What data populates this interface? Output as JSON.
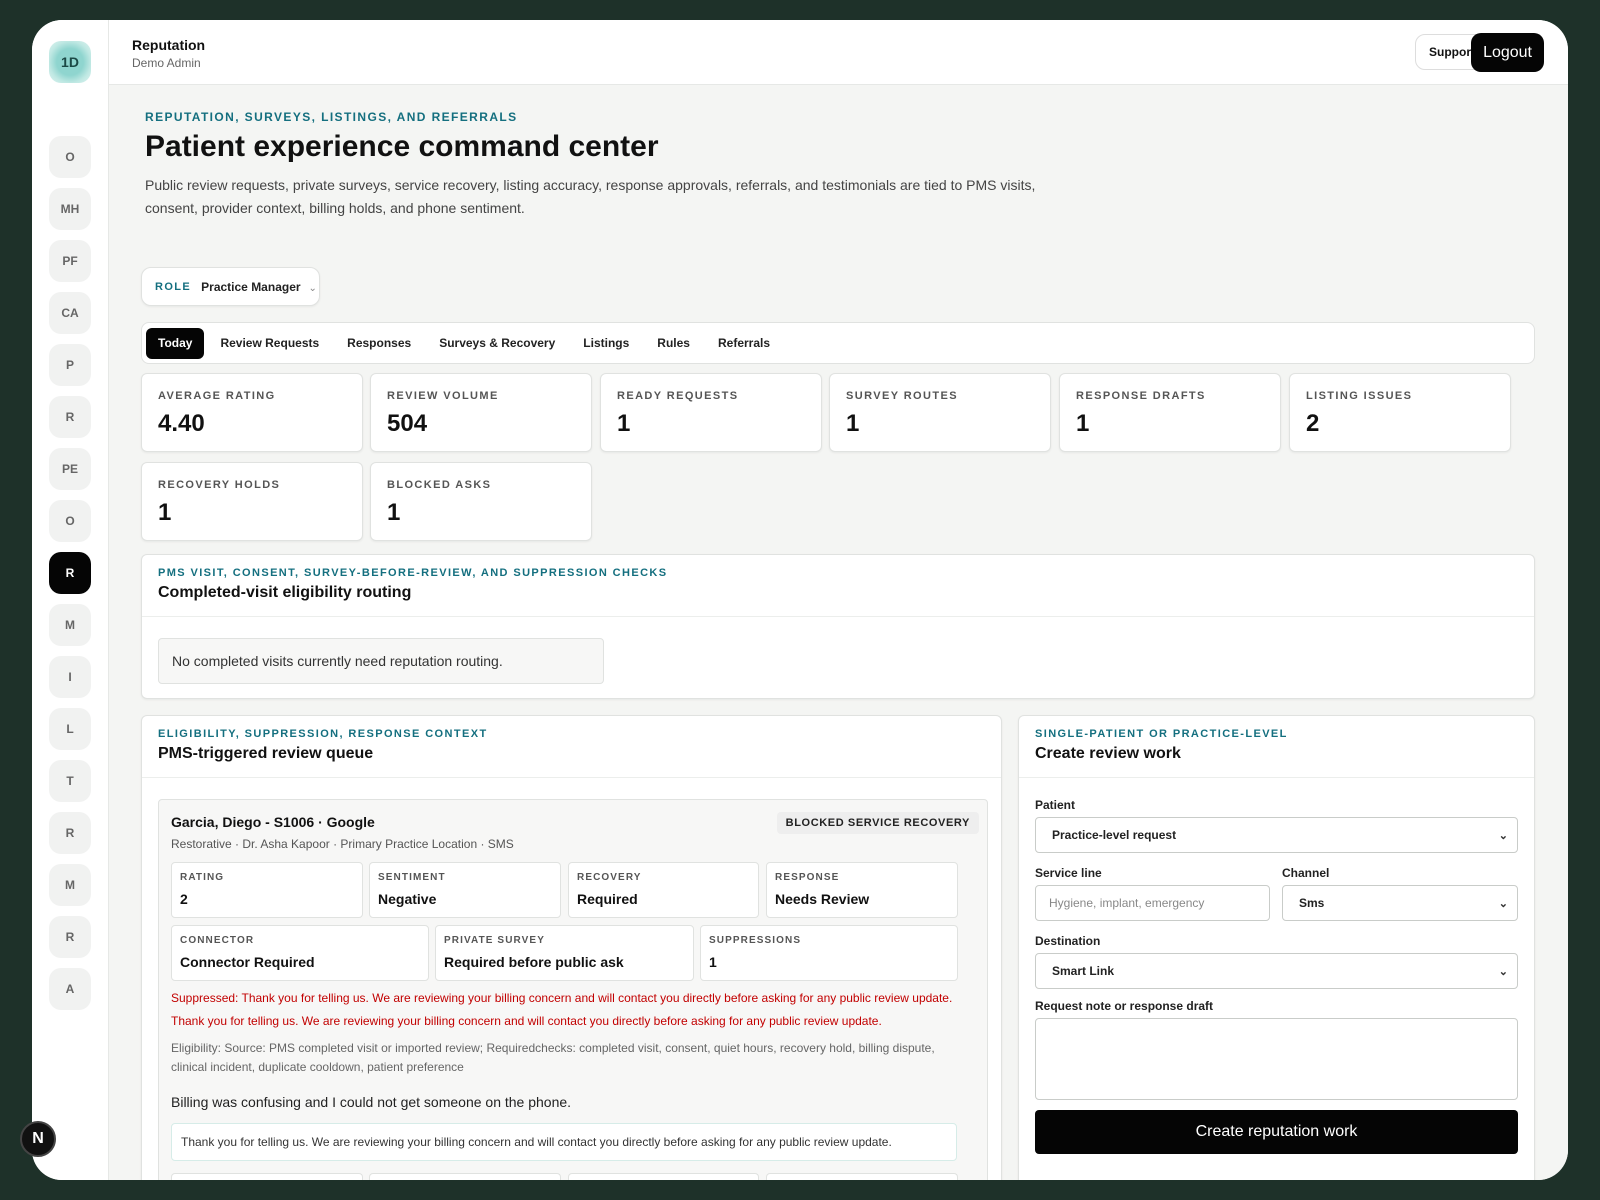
{
  "app": {
    "badge": "1D",
    "title": "Reputation",
    "subtitle": "Demo Admin",
    "support_label": "Support",
    "logout_label": "Logout"
  },
  "rail": [
    {
      "label": "O"
    },
    {
      "label": "MH"
    },
    {
      "label": "PF"
    },
    {
      "label": "CA"
    },
    {
      "label": "P"
    },
    {
      "label": "R"
    },
    {
      "label": "PE"
    },
    {
      "label": "O"
    },
    {
      "label": "R",
      "active": true
    },
    {
      "label": "M"
    },
    {
      "label": "I"
    },
    {
      "label": "L"
    },
    {
      "label": "T"
    },
    {
      "label": "R"
    },
    {
      "label": "M"
    },
    {
      "label": "R"
    },
    {
      "label": "A"
    }
  ],
  "page": {
    "kicker": "REPUTATION, SURVEYS, LISTINGS, AND REFERRALS",
    "title": "Patient experience command center",
    "description": "Public review requests, private surveys, service recovery, listing accuracy, response approvals, referrals, and testimonials are tied to PMS visits, consent, provider context, billing holds, and phone sentiment."
  },
  "role": {
    "label": "ROLE",
    "value": "Practice Manager"
  },
  "tabs": [
    "Today",
    "Review Requests",
    "Responses",
    "Surveys & Recovery",
    "Listings",
    "Rules",
    "Referrals"
  ],
  "stats": [
    {
      "label": "AVERAGE RATING",
      "value": "4.40"
    },
    {
      "label": "REVIEW VOLUME",
      "value": "504"
    },
    {
      "label": "READY REQUESTS",
      "value": "1"
    },
    {
      "label": "SURVEY ROUTES",
      "value": "1"
    },
    {
      "label": "RESPONSE DRAFTS",
      "value": "1"
    },
    {
      "label": "LISTING ISSUES",
      "value": "2"
    },
    {
      "label": "RECOVERY HOLDS",
      "value": "1"
    },
    {
      "label": "BLOCKED ASKS",
      "value": "1"
    }
  ],
  "routing": {
    "kicker": "PMS VISIT, CONSENT, SURVEY-BEFORE-REVIEW, AND SUPPRESSION CHECKS",
    "title": "Completed-visit eligibility routing",
    "empty": "No completed visits currently need reputation routing."
  },
  "queue": {
    "kicker": "ELIGIBILITY, SUPPRESSION, RESPONSE CONTEXT",
    "title": "PMS-triggered review queue",
    "item": {
      "title": "Garcia, Diego - S1006 · Google",
      "subtitle": "Restorative · Dr. Asha Kapoor · Primary Practice Location · SMS",
      "badge": "BLOCKED SERVICE RECOVERY",
      "fields": [
        {
          "label": "RATING",
          "value": "2"
        },
        {
          "label": "SENTIMENT",
          "value": "Negative"
        },
        {
          "label": "RECOVERY",
          "value": "Required"
        },
        {
          "label": "RESPONSE",
          "value": "Needs Review"
        },
        {
          "label": "CONNECTOR",
          "value": "Connector Required"
        },
        {
          "label": "PRIVATE SURVEY",
          "value": "Required before public ask"
        },
        {
          "label": "SUPPRESSIONS",
          "value": "1"
        }
      ],
      "suppressed": "Suppressed: Thank you for telling us. We are reviewing your billing concern and will contact you directly before asking for any public review update.",
      "warning": "Thank you for telling us. We are reviewing your billing concern and will contact you directly before asking for any public review update.",
      "eligibility": "Eligibility: Source: PMS completed visit or imported review; Requiredchecks: completed visit, consent, quiet hours, recovery hold, billing dispute, clinical incident, duplicate cooldown, patient preference",
      "review_text": "Billing was confusing and I could not get someone on the phone.",
      "response_draft": "Thank you for telling us. We are reviewing your billing concern and will contact you directly before asking for any public review update."
    }
  },
  "create": {
    "kicker": "SINGLE-PATIENT OR PRACTICE-LEVEL",
    "title": "Create review work",
    "patient_label": "Patient",
    "patient_value": "Practice-level request",
    "service_label": "Service line",
    "service_placeholder": "Hygiene, implant, emergency",
    "channel_label": "Channel",
    "channel_value": "Sms",
    "destination_label": "Destination",
    "destination_value": "Smart Link",
    "note_label": "Request note or response draft",
    "submit_label": "Create reputation work"
  },
  "dev_badge": "N"
}
